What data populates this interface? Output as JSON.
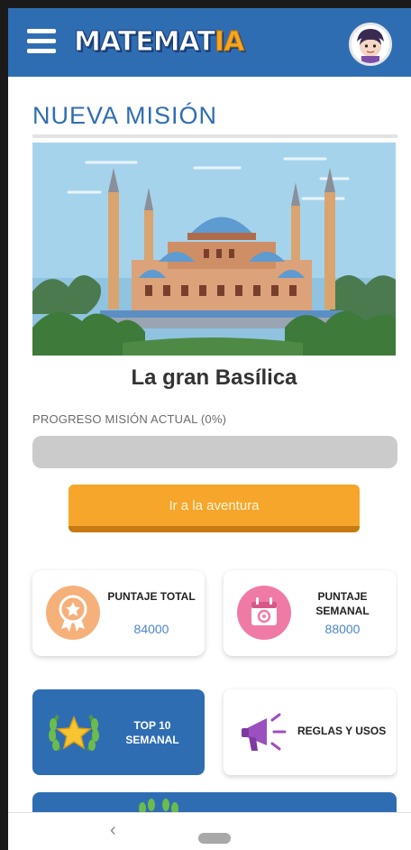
{
  "app": {
    "logo_part1": "MATEMAT",
    "logo_part2": "IA",
    "brand_color": "#2f6db3",
    "accent_color": "#f6a623"
  },
  "header": {
    "menu_icon": "hamburger-menu-icon",
    "avatar_icon": "user-avatar-icon"
  },
  "mission": {
    "section_title": "NUEVA MISIÓN",
    "name": "La gran Basílica",
    "progress_label": "PROGRESO MISIÓN ACTUAL (0%)",
    "progress_fraction": 0,
    "action_label": "Ir a la aventura"
  },
  "stats": {
    "total": {
      "title": "PUNTAJE TOTAL",
      "value": "84000",
      "icon": "award-medal-icon",
      "icon_color": "#f6b07a"
    },
    "weekly": {
      "title": "PUNTAJE SEMANAL",
      "value": "88000",
      "icon": "calendar-icon",
      "icon_color": "#f07aa6"
    }
  },
  "tiles": {
    "top10": {
      "label": "TOP 10 SEMANAL",
      "icon": "laurel-star-icon"
    },
    "rules": {
      "label": "REGLAS Y USOS",
      "icon": "megaphone-icon"
    }
  },
  "system_nav": {
    "back_glyph": "‹"
  }
}
